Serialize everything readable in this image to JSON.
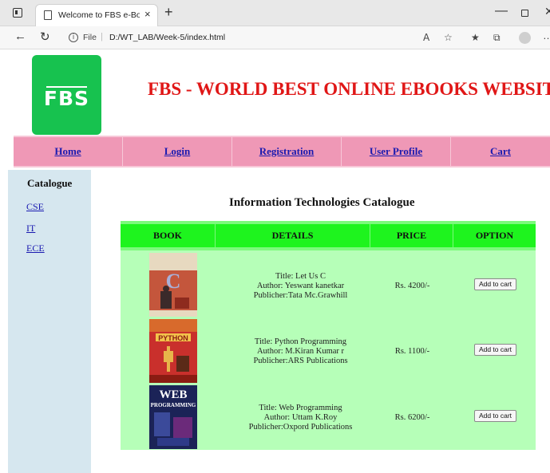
{
  "browser": {
    "tab_title": "Welcome to FBS e-Book's website",
    "tab_close": "×",
    "new_tab": "+",
    "url_scheme": "File",
    "url": "D:/WT_LAB/Week-5/index.html",
    "toolbar_icons": [
      "read-aloud-icon",
      "add-favorite-icon",
      "favorites-icon",
      "collections-icon",
      "profile-icon",
      "more-icon"
    ]
  },
  "header": {
    "logo_text": "FBS",
    "site_title": "FBS - WORLD BEST ONLINE EBOOKS WEBSITE"
  },
  "nav": {
    "items": [
      {
        "label": "Home"
      },
      {
        "label": "Login"
      },
      {
        "label": "Registration"
      },
      {
        "label": "User Profile"
      },
      {
        "label": "Cart"
      }
    ]
  },
  "sidebar": {
    "heading": "Catalogue",
    "links": [
      {
        "label": "CSE"
      },
      {
        "label": "IT"
      },
      {
        "label": "ECE"
      }
    ]
  },
  "main": {
    "title": "Information Technologies Catalogue",
    "table": {
      "headers": [
        "BOOK",
        "DETAILS",
        "PRICE",
        "OPTION"
      ],
      "rows": [
        {
          "title": "Title: Let Us C",
          "author": "Author: Yeswant kanetkar",
          "publisher": "Publicher:Tata Mc.Grawhill",
          "price": "Rs. 4200/-",
          "button": "Add to cart"
        },
        {
          "title": "Title: Python Programming",
          "author": "Author: M.Kiran Kumar r",
          "publisher": "Publicher:ARS Publications",
          "price": "Rs. 1100/-",
          "button": "Add to cart"
        },
        {
          "title": "Title: Web Programming",
          "author": "Author: Uttam K.Roy",
          "publisher": "Publicher:Oxpord Publications",
          "price": "Rs. 6200/-",
          "button": "Add to cart"
        }
      ]
    }
  },
  "colors": {
    "title_red": "#e01717",
    "nav_pink": "#ef98b6",
    "sidebar_blue": "#d6e7ef",
    "table_header_green": "#1ef41e",
    "table_body_green": "#b6ffb8",
    "logo_green": "#17c24f"
  }
}
